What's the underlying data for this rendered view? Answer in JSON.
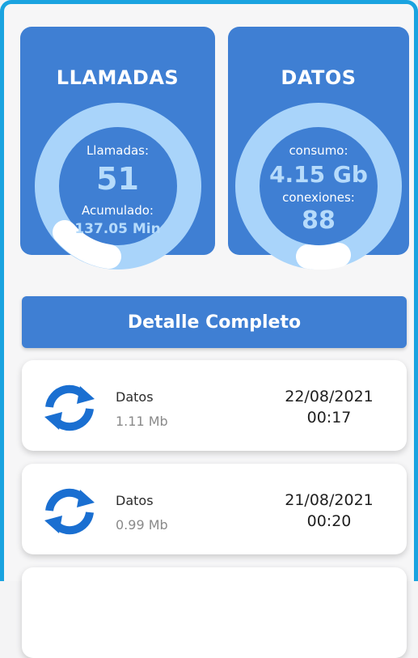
{
  "calls": {
    "title": "LLAMADAS",
    "label1": "Llamadas:",
    "count": "51",
    "label2": "Acumulado:",
    "accumulated": "137.05 Min",
    "progress": 0.08
  },
  "data": {
    "title": "DATOS",
    "label1": "consumo:",
    "consumption": "4.15 Gb",
    "label2": "conexiones:",
    "connections": "88",
    "progress": 0.05
  },
  "detail_button": {
    "label": "Detalle Completo"
  },
  "history": [
    {
      "icon": "sync-icon",
      "kind": "Datos",
      "size": "1.11 Mb",
      "date": "22/08/2021",
      "time": "00:17"
    },
    {
      "icon": "sync-icon",
      "kind": "Datos",
      "size": "0.99 Mb",
      "date": "21/08/2021",
      "time": "00:20"
    }
  ],
  "colors": {
    "card": "#3f7fd3",
    "ring": "#a9d4fa",
    "accent": "#1a6fd1",
    "frame": "#1aa3e0"
  }
}
